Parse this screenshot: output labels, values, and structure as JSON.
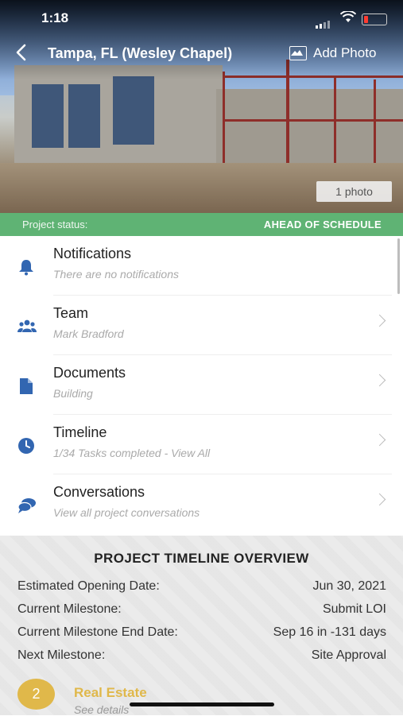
{
  "status_bar": {
    "time": "1:18"
  },
  "header": {
    "title": "Tampa, FL (Wesley Chapel)",
    "add_photo_label": "Add Photo",
    "photo_count": "1 photo"
  },
  "project_status": {
    "label": "Project status:",
    "value": "AHEAD OF SCHEDULE",
    "color": "#5fb374"
  },
  "menu": [
    {
      "title": "Notifications",
      "subtitle": "There are no notifications",
      "icon": "bell-icon",
      "has_chevron": false
    },
    {
      "title": "Team",
      "subtitle": "Mark Bradford",
      "icon": "team-icon",
      "has_chevron": true
    },
    {
      "title": "Documents",
      "subtitle": "Building",
      "icon": "document-icon",
      "has_chevron": true
    },
    {
      "title": "Timeline",
      "subtitle": "1/34 Tasks completed - View All",
      "icon": "clock-icon",
      "has_chevron": true
    },
    {
      "title": "Conversations",
      "subtitle": "View all project conversations",
      "icon": "chat-icon",
      "has_chevron": true
    }
  ],
  "overview": {
    "title": "PROJECT TIMELINE OVERVIEW",
    "rows": [
      {
        "label": "Estimated Opening Date:",
        "value": "Jun 30, 2021"
      },
      {
        "label": "Current Milestone:",
        "value": "Submit LOI"
      },
      {
        "label": "Current Milestone End Date:",
        "value": "Sep 16 in -131 days"
      },
      {
        "label": "Next Milestone:",
        "value": "Site Approval"
      }
    ],
    "milestone": {
      "number": "2",
      "label": "Real Estate",
      "sub": "See details",
      "color": "#e0b84a"
    }
  },
  "accent_color": "#3266b1"
}
